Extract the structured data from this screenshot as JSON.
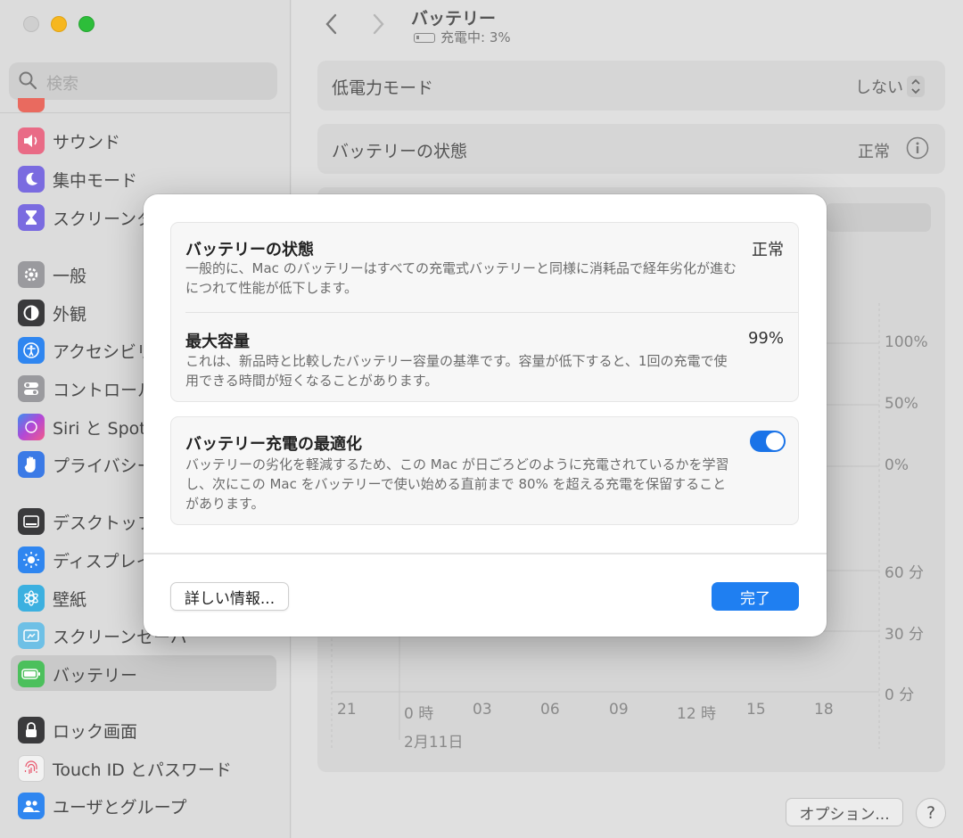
{
  "sidebar": {
    "search_placeholder": "検索",
    "items": [
      {
        "label": "サウンド",
        "icon": "speaker-icon",
        "color": "#e0567a"
      },
      {
        "label": "集中モード",
        "icon": "moon-icon",
        "color": "#6b5bd6"
      },
      {
        "label": "スクリーンタ",
        "icon": "hourglass-icon",
        "color": "#6b5bd6"
      },
      {
        "label": "一般",
        "icon": "gear-icon",
        "color": "#8e8e93"
      },
      {
        "label": "外観",
        "icon": "appearance-icon",
        "color": "#1c1c1e"
      },
      {
        "label": "アクセシビリ",
        "icon": "accessibility-icon",
        "color": "#1a7cf2"
      },
      {
        "label": "コントロール",
        "icon": "control-center-icon",
        "color": "#8e8e93"
      },
      {
        "label": "Siri と Spotl",
        "icon": "siri-icon",
        "color": "#8b5cd6"
      },
      {
        "label": "プライバシー",
        "icon": "hand-icon",
        "color": "#2f6fe0"
      },
      {
        "label": "デスクトップ",
        "icon": "desktop-icon",
        "color": "#1c1c1e"
      },
      {
        "label": "ディスプレイ",
        "icon": "brightness-icon",
        "color": "#1a7cf2"
      },
      {
        "label": "壁紙",
        "icon": "wallpaper-icon",
        "color": "#34aadc"
      },
      {
        "label": "スクリーンセーバ",
        "icon": "screensaver-icon",
        "color": "#4fb3e0"
      },
      {
        "label": "バッテリー",
        "icon": "battery-icon",
        "color": "#3dbb52"
      },
      {
        "label": "ロック画面",
        "icon": "lock-icon",
        "color": "#1c1c1e"
      },
      {
        "label": "Touch ID とパスワード",
        "icon": "fingerprint-icon",
        "color": "#ffffff"
      },
      {
        "label": "ユーザとグループ",
        "icon": "users-icon",
        "color": "#1a7cf2"
      }
    ]
  },
  "header": {
    "title": "バッテリー",
    "subtitle": "充電中: 3%"
  },
  "rows": {
    "low_power_label": "低電力モード",
    "low_power_value": "しない",
    "health_label": "バッテリーの状態",
    "health_value": "正常"
  },
  "chart_axes": {
    "level_ticks": [
      "100%",
      "50%",
      "0%"
    ],
    "time_ticks": [
      "60 分",
      "30 分",
      "0 分"
    ],
    "x_ticks": [
      "21",
      "0 時",
      "03",
      "06",
      "09",
      "12 時",
      "15",
      "18"
    ],
    "date": "2月11日"
  },
  "footer": {
    "options": "オプション...",
    "help": "?"
  },
  "sheet": {
    "health_title": "バッテリーの状態",
    "health_value": "正常",
    "health_desc": "一般的に、Mac のバッテリーはすべての充電式バッテリーと同様に消耗品で経年劣化が進むにつれて性能が低下します。",
    "capacity_title": "最大容量",
    "capacity_value": "99%",
    "capacity_desc": "これは、新品時と比較したバッテリー容量の基準です。容量が低下すると、1回の充電で使用できる時間が短くなることがあります。",
    "opt_title": "バッテリー充電の最適化",
    "opt_desc": "バッテリーの劣化を軽減するため、この Mac が日ごろどのように充電されているかを学習し、次にこの Mac をバッテリーで使い始める直前まで 80% を超える充電を保留することがあります。",
    "opt_enabled": true,
    "more_button": "詳しい情報...",
    "done_button": "完了"
  }
}
